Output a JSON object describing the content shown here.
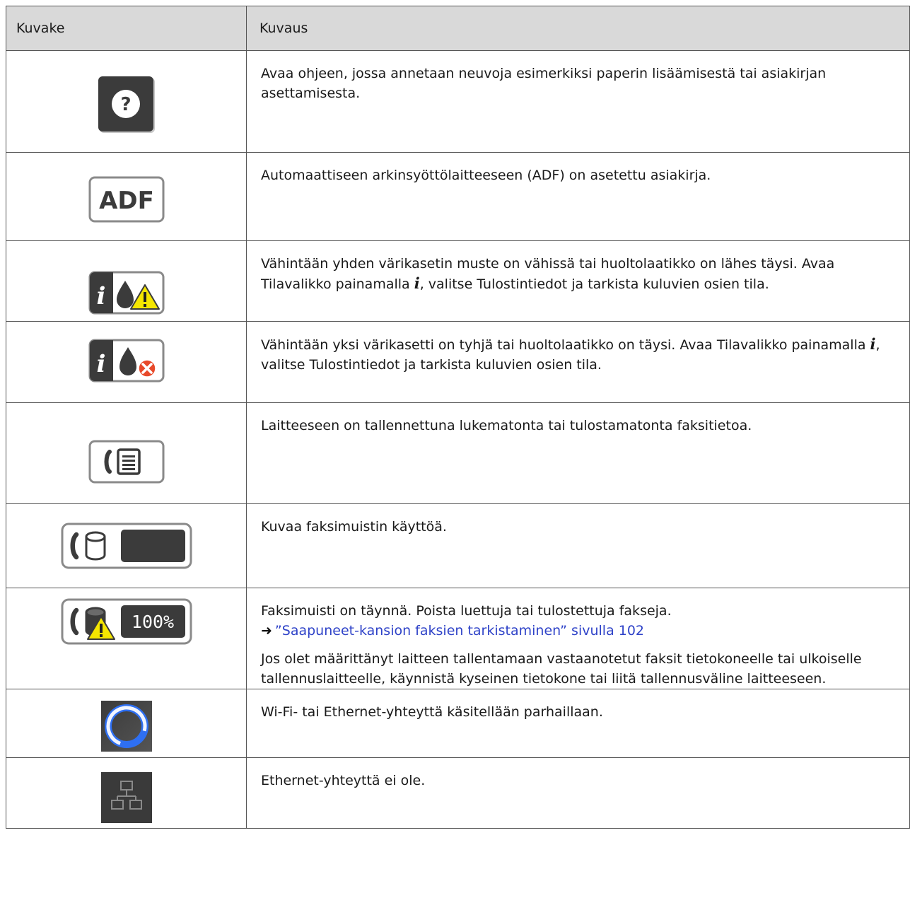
{
  "header": {
    "col_icon": "Kuvake",
    "col_desc": "Kuvaus"
  },
  "rows": [
    {
      "icon": "help-icon",
      "text": "Avaa ohjeen, jossa annetaan neuvoja esimerkiksi paperin lisäämisestä tai asiakirjan asettamisesta."
    },
    {
      "icon": "adf-icon",
      "icon_text": "ADF",
      "text": "Automaattiseen arkinsyöttölaitteeseen (ADF) on asetettu asiakirja."
    },
    {
      "icon": "ink-warning-icon",
      "text_a": "Vähintään yhden värikasetin muste on vähissä tai huoltolaatikko on lähes täysi. Avaa Tilavalikko painamalla ",
      "text_b": ", valitse Tulostintiedot ja tarkista kuluvien osien tila."
    },
    {
      "icon": "ink-error-icon",
      "text_a": "Vähintään yksi värikasetti on tyhjä tai huoltolaatikko on täysi. Avaa Tilavalikko painamalla ",
      "text_b": ", valitse Tulostintiedot ja tarkista kuluvien osien tila."
    },
    {
      "icon": "fax-data-icon",
      "text": "Laitteeseen on tallennettuna lukematonta tai tulostamatonta faksitietoa."
    },
    {
      "icon": "fax-memory-icon",
      "text": "Kuvaa faksimuistin käyttöä."
    },
    {
      "icon": "fax-memory-full-icon",
      "icon_text": "100%",
      "text": "Faksimuisti on täynnä. Poista luettuja tai tulostettuja fakseja.",
      "link": "”Saapuneet-kansion faksien tarkistaminen” sivulla 102",
      "text2": "Jos olet määrittänyt laitteen tallentamaan vastaanotetut faksit tietokoneelle tai ulkoiselle tallennuslaitteelle, käynnistä kyseinen tietokone tai liitä tallennusväline laitteeseen."
    },
    {
      "icon": "connecting-icon",
      "text": "Wi-Fi- tai Ethernet-yhteyttä käsitellään parhaillaan."
    },
    {
      "icon": "ethernet-disconnected-icon",
      "text": "Ethernet-yhteyttä ei ole."
    }
  ],
  "colors": {
    "header_bg": "#d9d9d9",
    "link": "#2f43c8",
    "warning": "#f5e600",
    "error": "#e8492a",
    "connecting": "#2e6ff2"
  }
}
